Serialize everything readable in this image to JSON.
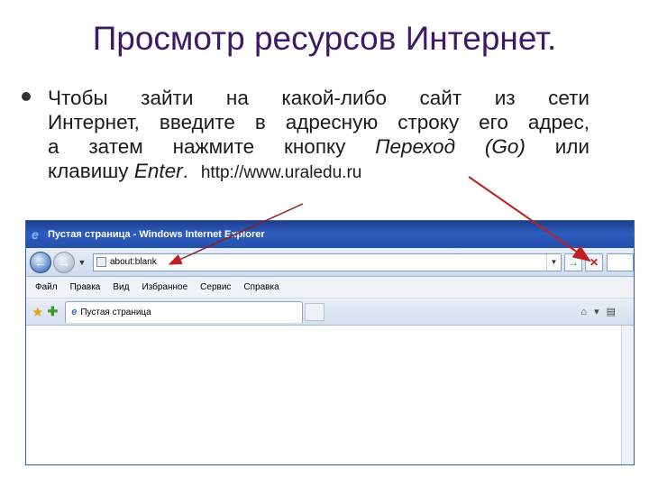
{
  "slide": {
    "title": "Просмотр ресурсов Интернет.",
    "body": {
      "line1": "Чтобы зайти на какой-либо сайт из сети",
      "line2": "Интернет, введите в адресную строку его адрес,",
      "line3_pre": "а затем нажмите кнопку ",
      "line3_em": "Переход (Go)",
      "line3_post": " или",
      "line4_pre": "клавишу ",
      "line4_em": "Enter",
      "line4_post": ".",
      "url": "http://www.uraledu.ru"
    }
  },
  "browser": {
    "window_title": "Пустая страница - Windows Internet Explorer",
    "address_value": "about:blank",
    "menu": [
      "Файл",
      "Правка",
      "Вид",
      "Избранное",
      "Сервис",
      "Справка"
    ],
    "tab_label": "Пустая страница"
  },
  "colors": {
    "title": "#3d1a66",
    "arrow": "#c21f1f",
    "titlebar": "#2450ad"
  },
  "icons": [
    "back-arrow-icon",
    "forward-arrow-icon",
    "go-icon",
    "stop-icon",
    "favorites-star-icon",
    "add-favorites-icon",
    "ie-logo-icon",
    "home-icon",
    "feeds-icon"
  ]
}
